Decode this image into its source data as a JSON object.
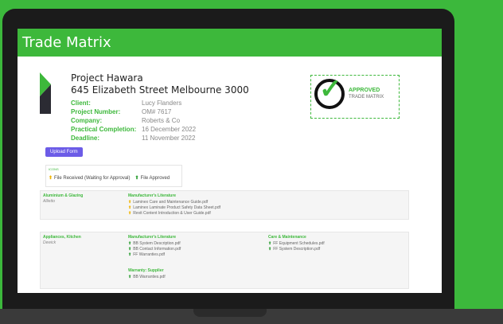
{
  "app": {
    "title": "Trade Matrix"
  },
  "project": {
    "name": "Project Hawara",
    "address": "645 Elizabeth Street Melbourne 3000",
    "fields": [
      {
        "label": "Client:",
        "value": "Lucy Flanders"
      },
      {
        "label": "Project Number:",
        "value": "OM# 7617"
      },
      {
        "label": "Company:",
        "value": "Roberts & Co"
      },
      {
        "label": "Practical Completion:",
        "value": "16 December 2022"
      },
      {
        "label": "Deadline:",
        "value": "11 November 2022"
      }
    ]
  },
  "stamp": {
    "line1": "APPROVED",
    "line2": "TRADE MATRIX"
  },
  "upload_button": "Upload Form",
  "icons_legend": {
    "heading": "ICONS",
    "items": [
      "File Received (Waiting for Approval)",
      "File Approved"
    ]
  },
  "trades": [
    {
      "name": "Aluminium & Glazing",
      "supplier": "Allietto",
      "columns": [
        {
          "heading": "Manufacturer's Literature",
          "files": [
            {
              "name": "Laminex Care and Maintenance Guide.pdf",
              "status": "received"
            },
            {
              "name": "Laminex Laminate Product Safety Data Sheet.pdf",
              "status": "received"
            },
            {
              "name": "Revit Content Introduction & User Guide.pdf",
              "status": "received"
            }
          ]
        }
      ]
    },
    {
      "name": "Appliances, Kitchen",
      "supplier": "Dewick",
      "columns": [
        {
          "heading": "Manufacturer's Literature",
          "files": [
            {
              "name": "BB System Description.pdf",
              "status": "approved"
            },
            {
              "name": "BB Contact Information.pdf",
              "status": "approved"
            },
            {
              "name": "FF Warranties.pdf",
              "status": "approved"
            }
          ]
        },
        {
          "heading": "Care & Maintenance",
          "files": [
            {
              "name": "FF Equipment Schedules.pdf",
              "status": "approved"
            },
            {
              "name": "FF System Description.pdf",
              "status": "approved"
            }
          ]
        },
        {
          "heading": "Warranty: Supplier",
          "files": [
            {
              "name": "BB Warranties.pdf",
              "status": "approved"
            }
          ]
        }
      ]
    }
  ]
}
